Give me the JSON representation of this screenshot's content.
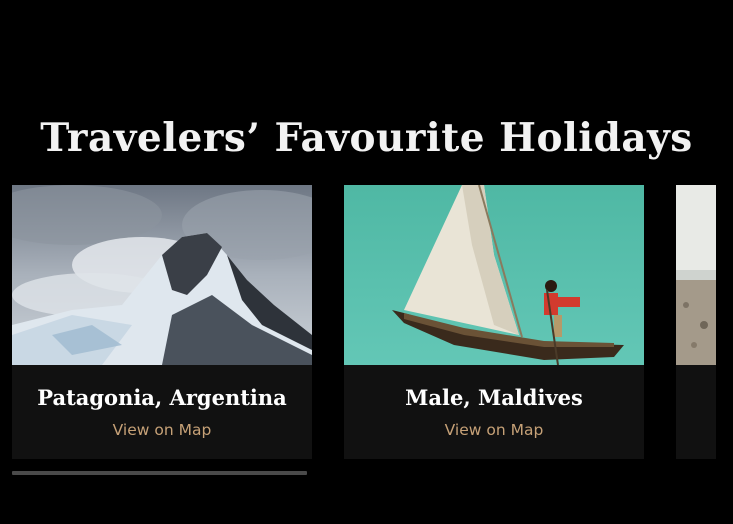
{
  "section": {
    "title": "Travelers’ Favourite Holidays"
  },
  "cards": [
    {
      "name": "Patagonia, Argentina",
      "link_label": "View on Map",
      "image": "snowy-mountain-peak-photo"
    },
    {
      "name": "Male, Maldives",
      "link_label": "View on Map",
      "image": "sailboat-on-turquoise-sea-photo"
    },
    {
      "name": "",
      "link_label": "",
      "image": "beach-shore-photo"
    }
  ],
  "carousel": {
    "scroll_progress": 0.41
  },
  "colors": {
    "background": "#000000",
    "card": "#111111",
    "link": "#c6a177",
    "title": "#f2f2f2"
  }
}
